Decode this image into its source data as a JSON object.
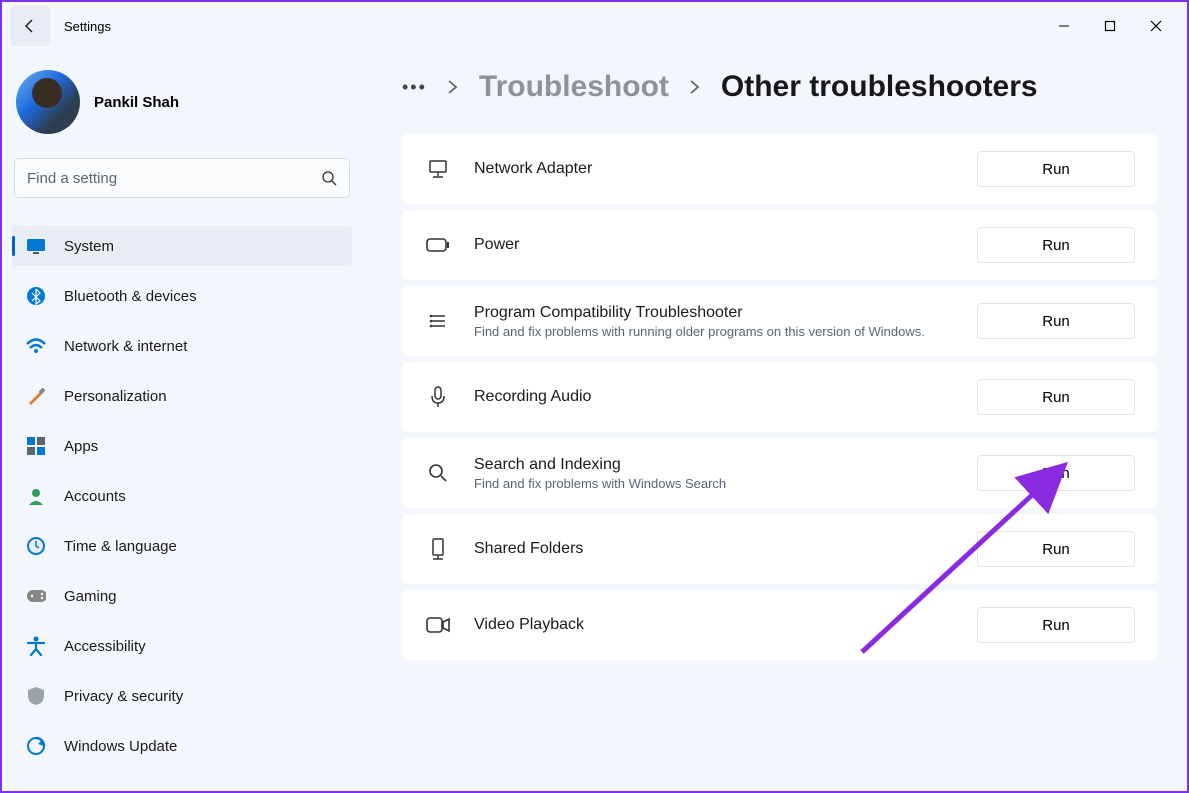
{
  "app_title": "Settings",
  "profile": {
    "name": "Pankil Shah"
  },
  "search": {
    "placeholder": "Find a setting"
  },
  "nav": [
    {
      "label": "System",
      "icon": "system",
      "selected": true
    },
    {
      "label": "Bluetooth & devices",
      "icon": "bluetooth"
    },
    {
      "label": "Network & internet",
      "icon": "wifi"
    },
    {
      "label": "Personalization",
      "icon": "brush"
    },
    {
      "label": "Apps",
      "icon": "apps"
    },
    {
      "label": "Accounts",
      "icon": "person"
    },
    {
      "label": "Time & language",
      "icon": "clock"
    },
    {
      "label": "Gaming",
      "icon": "game"
    },
    {
      "label": "Accessibility",
      "icon": "accessibility"
    },
    {
      "label": "Privacy & security",
      "icon": "shield"
    },
    {
      "label": "Windows Update",
      "icon": "update"
    }
  ],
  "breadcrumb": {
    "parent": "Troubleshoot",
    "current": "Other troubleshooters"
  },
  "troubleshooters": [
    {
      "title": "Network Adapter",
      "desc": "",
      "icon": "network",
      "run": "Run"
    },
    {
      "title": "Power",
      "desc": "",
      "icon": "power",
      "run": "Run"
    },
    {
      "title": "Program Compatibility Troubleshooter",
      "desc": "Find and fix problems with running older programs on this version of Windows.",
      "icon": "compat",
      "run": "Run"
    },
    {
      "title": "Recording Audio",
      "desc": "",
      "icon": "mic",
      "run": "Run"
    },
    {
      "title": "Search and Indexing",
      "desc": "Find and fix problems with Windows Search",
      "icon": "search",
      "run": "Run"
    },
    {
      "title": "Shared Folders",
      "desc": "",
      "icon": "folder",
      "run": "Run"
    },
    {
      "title": "Video Playback",
      "desc": "",
      "icon": "video",
      "run": "Run"
    }
  ]
}
